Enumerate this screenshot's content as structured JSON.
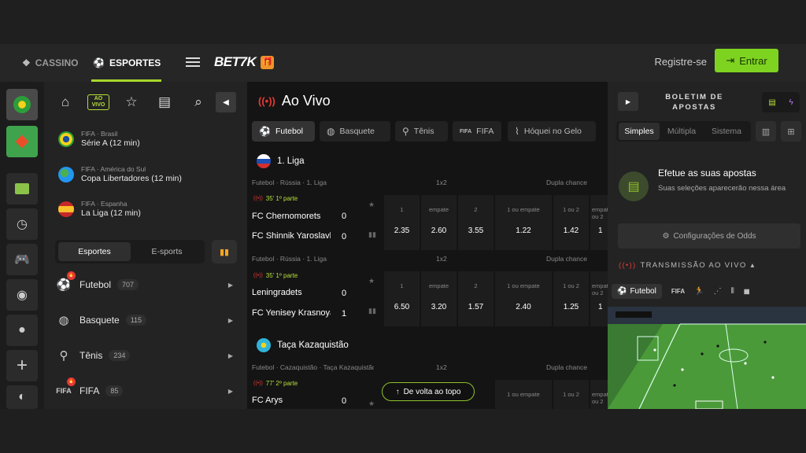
{
  "topbar": {
    "casino": "CASSINO",
    "esportes": "ESPORTES",
    "logo": "BET7K",
    "register": "Registre-se",
    "login": "Entrar"
  },
  "sidebar": {
    "favorites": [
      {
        "top": "FIFA · Brasil",
        "name": "Série A (12 min)"
      },
      {
        "top": "FIFA · América do Sul",
        "name": "Copa Libertadores (12 min)"
      },
      {
        "top": "FIFA · Espanha",
        "name": "La Liga (12 min)"
      }
    ],
    "tabs": {
      "esportes": "Esportes",
      "esports": "E-sports"
    },
    "live_label": "AO VIVO",
    "sports": [
      {
        "name": "Futebol",
        "count": "707"
      },
      {
        "name": "Basquete",
        "count": "115"
      },
      {
        "name": "Tênis",
        "count": "234"
      },
      {
        "name": "FIFA",
        "count": "85"
      }
    ]
  },
  "main": {
    "title": "Ao Vivo",
    "sport_tabs": [
      "Futebol",
      "Basquete",
      "Tênis",
      "FIFA",
      "Hóquei no Gelo"
    ],
    "leagues": [
      {
        "name": "1. Liga"
      },
      {
        "name": "Taça Kazaquistão"
      }
    ],
    "matches": [
      {
        "crumb": "Futebol · Rússia · 1. Liga",
        "market1": "1x2",
        "market2": "Dupla chance",
        "time": "35' 1º parte",
        "home": "FC Chernomorets",
        "away": "FC Shinnik Yaroslavl",
        "score_home": "0",
        "score_away": "0",
        "odds": [
          {
            "l": "1",
            "v": "2.35"
          },
          {
            "l": "empate",
            "v": "2.60"
          },
          {
            "l": "2",
            "v": "3.55"
          },
          {
            "l": "1 ou empate",
            "v": "1.22"
          },
          {
            "l": "1 ou 2",
            "v": "1.42"
          },
          {
            "l": "empate ou 2",
            "v": "1"
          }
        ]
      },
      {
        "crumb": "Futebol · Rússia · 1. Liga",
        "market1": "1x2",
        "market2": "Dupla chance",
        "time": "35' 1º parte",
        "home": "Leningradets",
        "away": "FC Yenisey Krasnoyarsk",
        "score_home": "0",
        "score_away": "1",
        "odds": [
          {
            "l": "1",
            "v": "6.50"
          },
          {
            "l": "empate",
            "v": "3.20"
          },
          {
            "l": "2",
            "v": "1.57"
          },
          {
            "l": "1 ou empate",
            "v": "2.40"
          },
          {
            "l": "1 ou 2",
            "v": "1.25"
          },
          {
            "l": "empate ou 2",
            "v": "1"
          }
        ]
      },
      {
        "crumb": "Futebol · Cazaquistão · Taça Kazaquistão",
        "market1": "1x2",
        "market2": "Dupla chance",
        "time": "77' 2º parte",
        "home": "FC Arys",
        "score_home": "0",
        "odds": [
          {
            "l": "1 ou empate"
          },
          {
            "l": "1 ou 2"
          },
          {
            "l": "empate ou 2"
          }
        ]
      }
    ],
    "back_to_top": "De volta ao topo"
  },
  "betslip": {
    "title": "BOLETIM DE APOSTAS",
    "tabs": [
      "Simples",
      "Múltipla",
      "Sistema"
    ],
    "empty_title": "Efetue as suas apostas",
    "empty_sub": "Suas seleções aparecerão nessa área",
    "odds_settings": "Configurações de Odds",
    "stream_title": "TRANSMISSÃO AO VIVO",
    "stream_tabs": [
      "Futebol",
      "FIFA"
    ]
  },
  "colors": {
    "accent": "#7ed321",
    "live": "#e53935",
    "bg": "#141414"
  }
}
